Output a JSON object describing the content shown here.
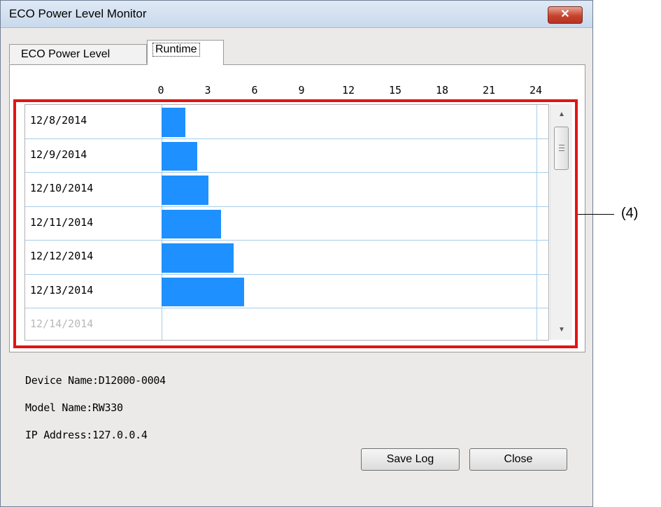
{
  "window": {
    "title": "ECO Power Level Monitor",
    "close_symbol": "✕"
  },
  "tabs": [
    {
      "label": "ECO Power Level",
      "selected": false
    },
    {
      "label": "Runtime",
      "selected": true
    }
  ],
  "chart_data": {
    "type": "bar",
    "orientation": "horizontal",
    "xticks": [
      "0",
      "3",
      "6",
      "9",
      "12",
      "15",
      "18",
      "21",
      "24"
    ],
    "xlim": [
      0,
      24
    ],
    "categories": [
      "12/8/2014",
      "12/9/2014",
      "12/10/2014",
      "12/11/2014",
      "12/12/2014",
      "12/13/2014",
      "12/14/2014"
    ],
    "values": [
      1.5,
      2.3,
      3.0,
      3.8,
      4.6,
      5.3,
      0
    ],
    "bar_color": "#1e90ff",
    "gridline_color": "#a7cde8",
    "grid": true
  },
  "scrollbar": {
    "up_symbol": "▲",
    "down_symbol": "▼"
  },
  "info": {
    "device_name": "Device Name:D12000-0004",
    "model_name": "Model Name:RW330",
    "ip_address": "IP Address:127.0.0.4"
  },
  "buttons": {
    "save_log": "Save Log",
    "close": "Close"
  },
  "annotation": {
    "label": "(4)",
    "highlight_color": "#e21414"
  }
}
